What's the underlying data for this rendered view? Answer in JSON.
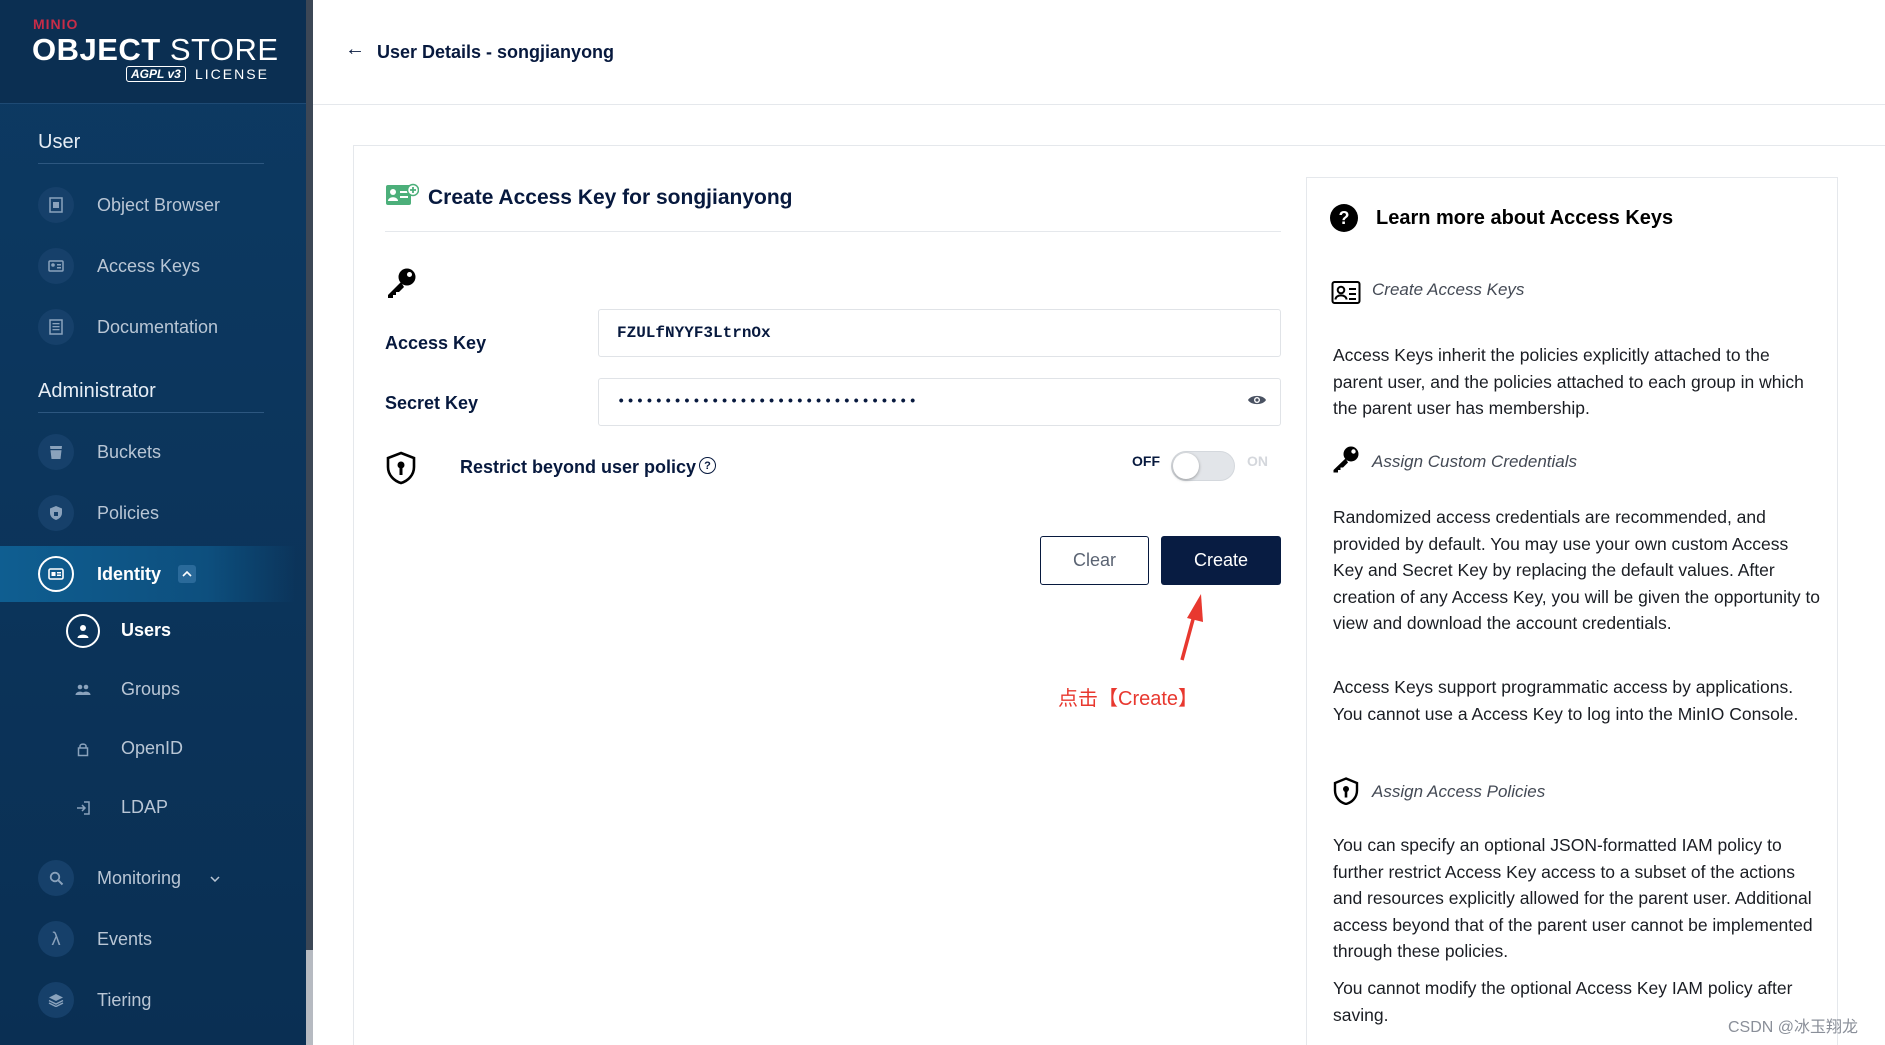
{
  "logo": {
    "brand": "MINIO",
    "product_bold": "OBJECT",
    "product_light": " STORE",
    "agpl": "AGPL v3",
    "license": "LICENSE"
  },
  "sidebar": {
    "user_section": "User",
    "user_items": [
      {
        "label": "Object Browser"
      },
      {
        "label": "Access Keys"
      },
      {
        "label": "Documentation"
      }
    ],
    "admin_section": "Administrator",
    "admin_items": [
      {
        "label": "Buckets"
      },
      {
        "label": "Policies"
      },
      {
        "label": "Identity"
      }
    ],
    "identity_sub": [
      {
        "label": "Users"
      },
      {
        "label": "Groups"
      },
      {
        "label": "OpenID"
      },
      {
        "label": "LDAP"
      }
    ],
    "bottom_items": [
      {
        "label": "Monitoring"
      },
      {
        "label": "Events"
      },
      {
        "label": "Tiering"
      }
    ]
  },
  "header": {
    "back_arrow": "←",
    "title": "User Details - songjianyong"
  },
  "form": {
    "title": "Create Access Key for songjianyong",
    "access_key_label": "Access Key",
    "access_key_value": "FZULfNYYF3LtrnOx",
    "secret_key_label": "Secret Key",
    "secret_key_value": "••••••••••••••••••••••••••••••••",
    "restrict_label": "Restrict beyond user policy",
    "help_mark": "?",
    "toggle_off": "OFF",
    "toggle_on": "ON",
    "toggle_state": "off",
    "clear_label": "Clear",
    "create_label": "Create"
  },
  "annotation": {
    "text": "点击【Create】",
    "color": "#e8382f"
  },
  "help": {
    "title": "Learn more about Access Keys",
    "title_mark": "?",
    "sections": [
      {
        "heading": "Create Access Keys",
        "paragraphs": [
          "Access Keys inherit the policies explicitly attached to the parent user, and the policies attached to each group in which the parent user has membership."
        ]
      },
      {
        "heading": "Assign Custom Credentials",
        "paragraphs": [
          "Randomized access credentials are recommended, and provided by default. You may use your own custom Access Key and Secret Key by replacing the default values. After creation of any Access Key, you will be given the opportunity to view and download the account credentials.",
          "Access Keys support programmatic access by applications. You cannot use a Access Key to log into the MinIO Console."
        ]
      },
      {
        "heading": "Assign Access Policies",
        "paragraphs": [
          "You can specify an optional JSON-formatted IAM policy to further restrict Access Key access to a subset of the actions and resources explicitly allowed for the parent user. Additional access beyond that of the parent user cannot be implemented through these policies.",
          "You cannot modify the optional Access Key IAM policy after saving."
        ]
      }
    ]
  },
  "watermark": "CSDN @冰玉翔龙",
  "colors": {
    "sidebar_bg": "#0d3a63",
    "primary_dark": "#081c42",
    "accent_green": "#4caf7a"
  }
}
